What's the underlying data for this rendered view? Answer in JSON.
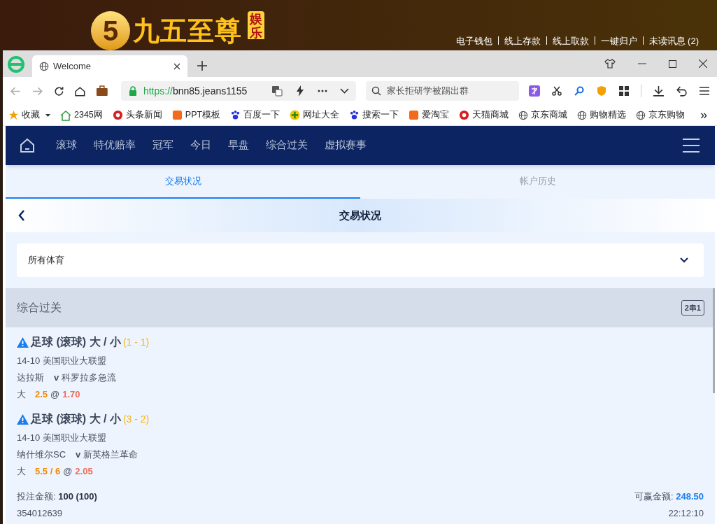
{
  "banner": {
    "logo_mark": "5",
    "logo_text": "九五至尊",
    "logo_badge": "娱乐",
    "links": [
      "电子钱包",
      "线上存款",
      "线上取款",
      "一键归户",
      "未读讯息 (2)"
    ]
  },
  "browser": {
    "tab_title": "Welcome",
    "url_scheme": "https://",
    "url_rest": "bnn85.jeans1155",
    "search_placeholder": "家长拒研学被踢出群",
    "bookmarks": [
      {
        "label": "收藏",
        "kind": "star"
      },
      {
        "label": "2345网",
        "kind": "house"
      },
      {
        "label": "头条新闻",
        "kind": "red"
      },
      {
        "label": "PPT模板",
        "kind": "orange"
      },
      {
        "label": "百度一下",
        "kind": "paw"
      },
      {
        "label": "网址大全",
        "kind": "plus"
      },
      {
        "label": "搜索一下",
        "kind": "paw"
      },
      {
        "label": "爱淘宝",
        "kind": "orange"
      },
      {
        "label": "天猫商城",
        "kind": "red"
      },
      {
        "label": "京东商城",
        "kind": "globe"
      },
      {
        "label": "购物精选",
        "kind": "globe"
      },
      {
        "label": "京东购物",
        "kind": "globe"
      }
    ],
    "more": "»"
  },
  "nav": {
    "items": [
      "滚球",
      "特优赔率",
      "冠军",
      "今日",
      "早盘",
      "综合过关",
      "虚拟赛事"
    ]
  },
  "tabs": [
    {
      "label": "交易状况",
      "selected": true
    },
    {
      "label": "帐户历史",
      "selected": false
    }
  ],
  "header": {
    "title": "交易状况"
  },
  "filter": {
    "value": "所有体育"
  },
  "section": {
    "title": "综合过关",
    "badge": "2串1"
  },
  "bets": [
    {
      "title": "足球 (滚球) 大 / 小",
      "score": "(1 - 1)",
      "league": "14-10 美国职业大联盟",
      "home": "达拉斯",
      "vs": "v",
      "away": "科罗拉多急流",
      "pick": "大",
      "line": "2.5",
      "sep": "@",
      "odds": "1.70"
    },
    {
      "title": "足球 (滚球) 大 / 小",
      "score": "(3 - 2)",
      "league": "14-10 美国职业大联盟",
      "home": "纳什维尔SC",
      "vs": "v",
      "away": "新英格兰革命",
      "pick": "大",
      "line": "5.5 / 6",
      "sep": "@",
      "odds": "2.05"
    }
  ],
  "summary": {
    "stake_label": "投注金额:",
    "stake": "100 (100)",
    "win_label": "可赢金额:",
    "win": "248.50",
    "ticket": "354012639",
    "time": "22:12:10"
  }
}
